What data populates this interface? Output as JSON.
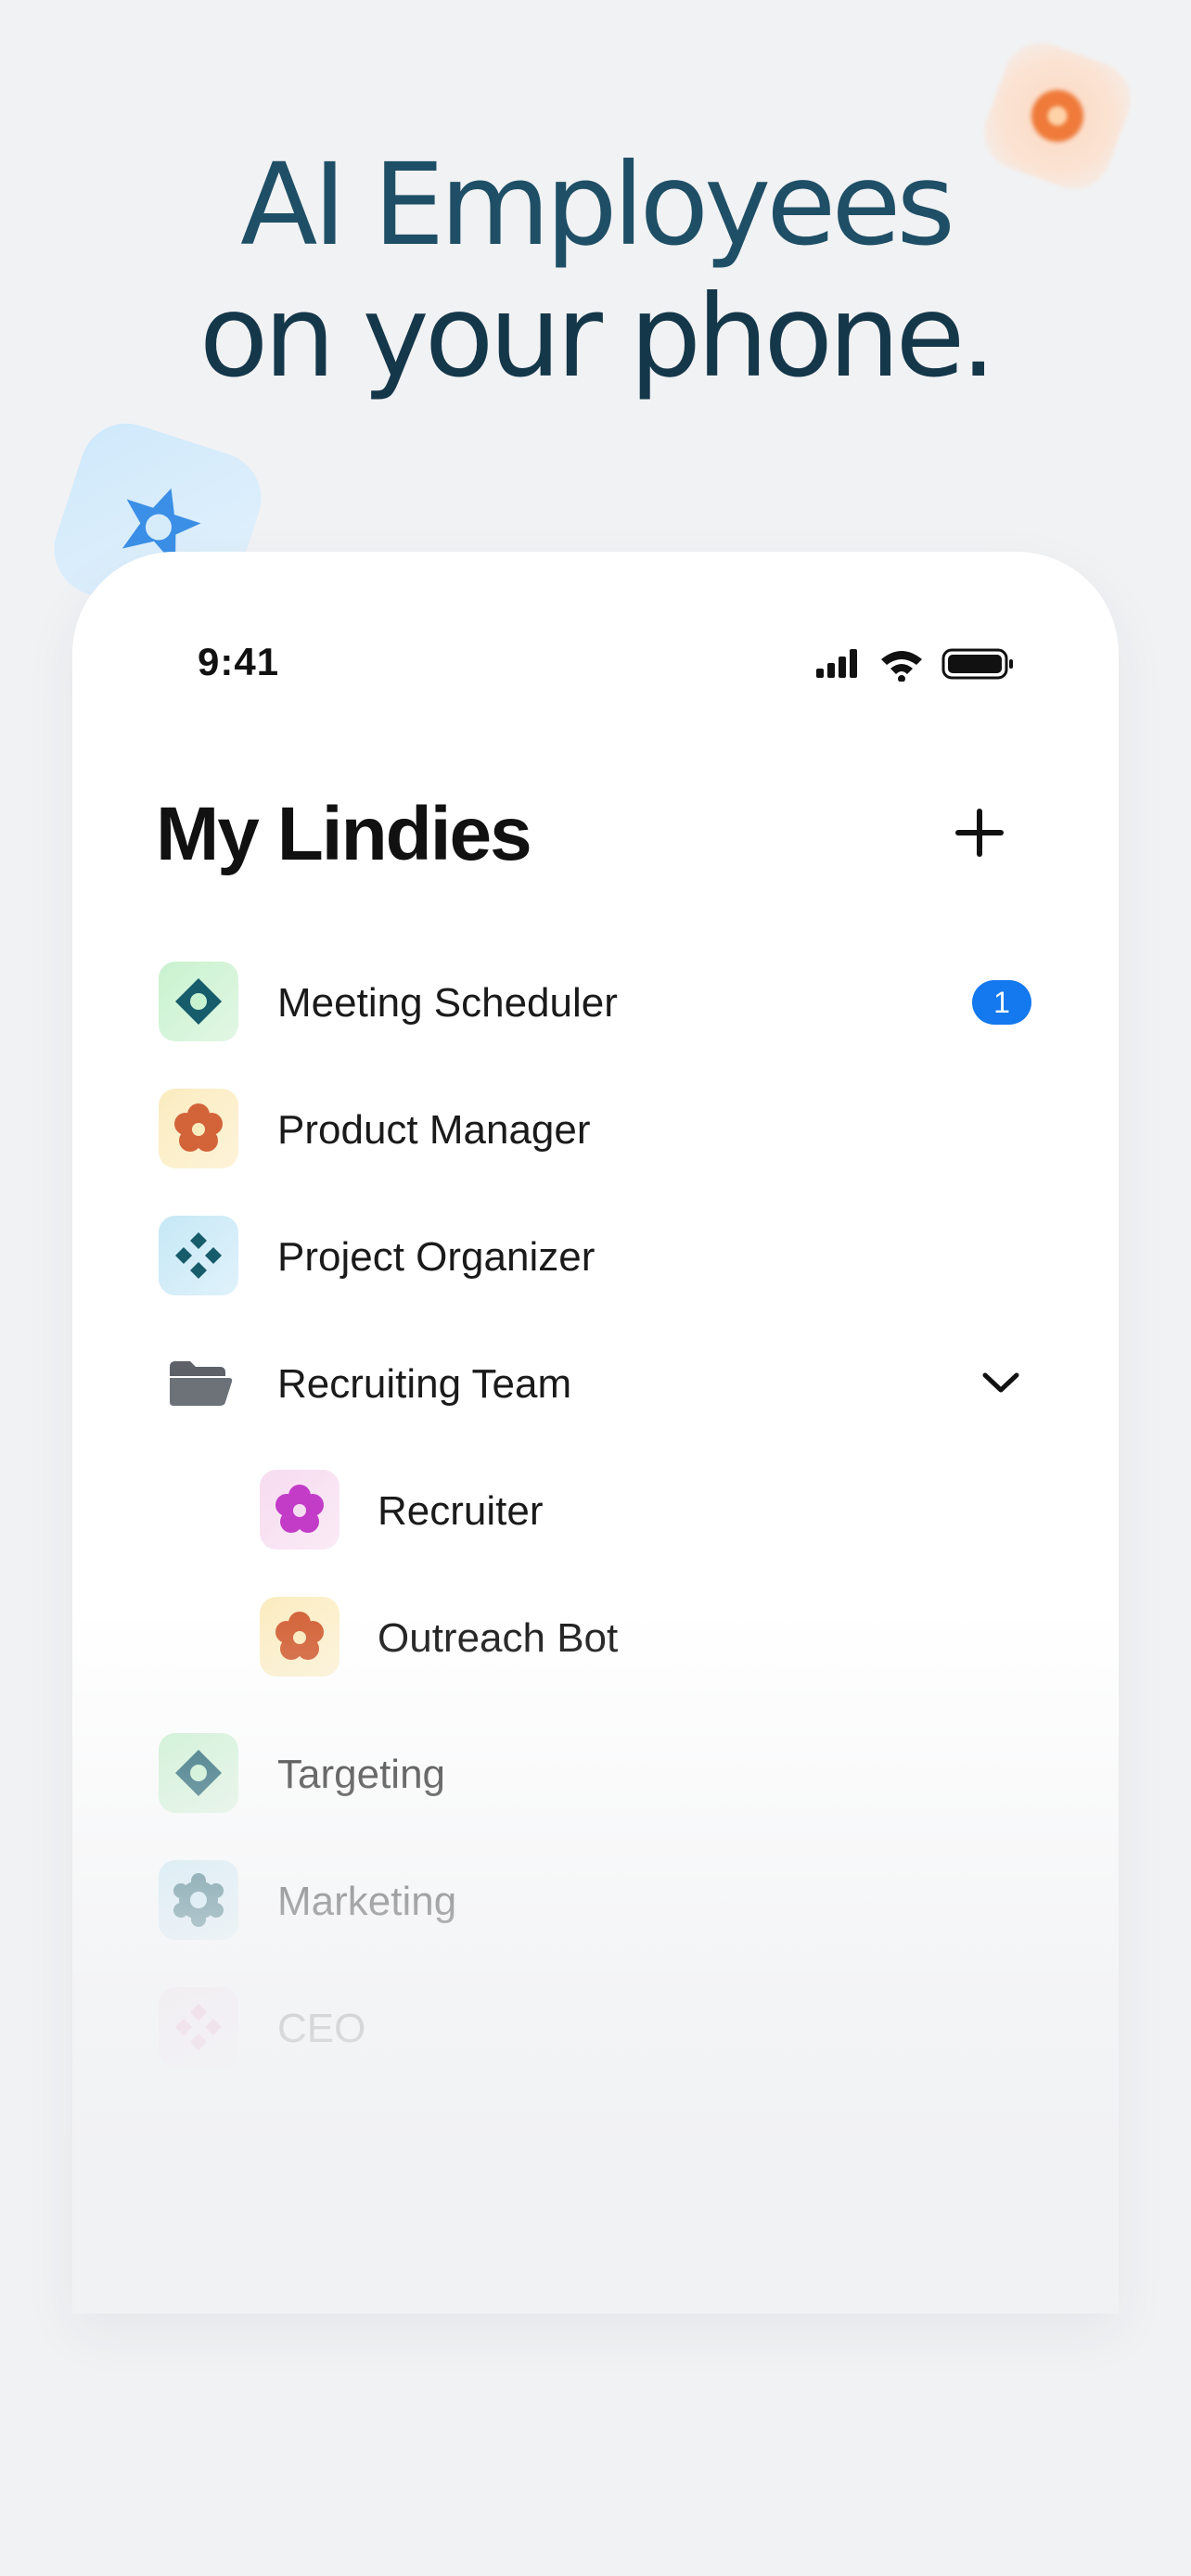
{
  "headline": {
    "line1": "AI Employees",
    "line2": "on your phone."
  },
  "status_bar": {
    "time": "9:41",
    "icons": [
      "signal-icon",
      "wifi-icon",
      "battery-icon"
    ]
  },
  "screen": {
    "title": "My Lindies",
    "add_icon": "plus-icon"
  },
  "items": [
    {
      "label": "Meeting Scheduler",
      "icon": "diamond-ring-icon",
      "badge": "1"
    },
    {
      "label": "Product Manager",
      "icon": "flower-icon"
    },
    {
      "label": "Project Organizer",
      "icon": "four-diamonds-icon"
    },
    {
      "label": "Recruiting Team",
      "icon": "folder-icon",
      "expanded": true
    },
    {
      "label": "Recruiter",
      "icon": "flower-icon"
    },
    {
      "label": "Outreach Bot",
      "icon": "flower-icon"
    },
    {
      "label": "Targeting",
      "icon": "diamond-ring-icon"
    },
    {
      "label": "Marketing",
      "icon": "gear-ring-icon"
    },
    {
      "label": "CEO",
      "icon": "four-diamonds-icon"
    }
  ],
  "colors": {
    "accent": "#1478ee",
    "headline_top": "#1f4f66",
    "headline_bottom": "#15374a",
    "icon_teal": "#165c6b",
    "icon_orange": "#d3643a",
    "icon_magenta": "#c23cc8",
    "icon_pink": "#ef7aae"
  }
}
